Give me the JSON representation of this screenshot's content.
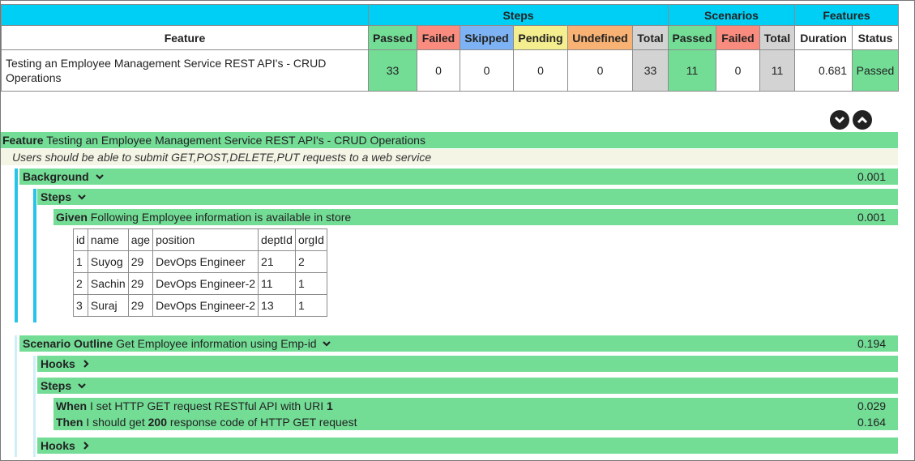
{
  "summary": {
    "groups": {
      "steps": "Steps",
      "scenarios": "Scenarios",
      "features": "Features"
    },
    "headers": {
      "feature": "Feature",
      "passed": "Passed",
      "failed": "Failed",
      "skipped": "Skipped",
      "pending": "Pending",
      "undefined": "Undefined",
      "total": "Total",
      "sc_passed": "Passed",
      "sc_failed": "Failed",
      "sc_total": "Total",
      "duration": "Duration",
      "status": "Status"
    },
    "row": {
      "feature": "Testing an Employee Management Service REST API's - CRUD Operations",
      "passed": "33",
      "failed": "0",
      "skipped": "0",
      "pending": "0",
      "undefined": "0",
      "total": "33",
      "sc_passed": "11",
      "sc_failed": "0",
      "sc_total": "11",
      "duration": "0.681",
      "status": "Passed"
    },
    "colors": {
      "header": "#00cff5",
      "passed": "#73dd96",
      "failed": "#f98c7e",
      "skipped": "#7db3f4",
      "pending": "#f4ee8f",
      "undefined": "#f7b274",
      "total": "#d3d3d3"
    }
  },
  "controls": {
    "collapse_all_icon": "chevron-down-icon",
    "expand_all_icon": "chevron-up-icon"
  },
  "feature": {
    "keyword": "Feature",
    "name": "Testing an Employee Management Service REST API's - CRUD Operations",
    "description": "Users should be able to submit GET,POST,DELETE,PUT requests to a web service"
  },
  "background": {
    "keyword": "Background",
    "duration": "0.001",
    "steps_label": "Steps",
    "step": {
      "keyword": "Given",
      "text": "Following Employee information is available in store",
      "duration": "0.001"
    },
    "table": {
      "headers": [
        "id",
        "name",
        "age",
        "position",
        "deptId",
        "orgId"
      ],
      "rows": [
        [
          "1",
          "Suyog",
          "29",
          "DevOps Engineer",
          "21",
          "2"
        ],
        [
          "2",
          "Sachin",
          "29",
          "DevOps Engineer-2",
          "11",
          "1"
        ],
        [
          "3",
          "Suraj",
          "29",
          "DevOps Engineer-2",
          "13",
          "1"
        ]
      ]
    }
  },
  "scenario": {
    "keyword": "Scenario Outline",
    "name": "Get Employee information using Emp-id",
    "duration": "0.194",
    "hooks_label": "Hooks",
    "steps_label": "Steps",
    "steps": [
      {
        "keyword": "When",
        "pre": "I set HTTP GET request RESTful API with URI",
        "bold": "1",
        "post": "",
        "duration": "0.029"
      },
      {
        "keyword": "Then",
        "pre": "I should get",
        "bold": "200",
        "post": "response code of HTTP GET request",
        "duration": "0.164"
      }
    ],
    "hooks_after_label": "Hooks"
  }
}
